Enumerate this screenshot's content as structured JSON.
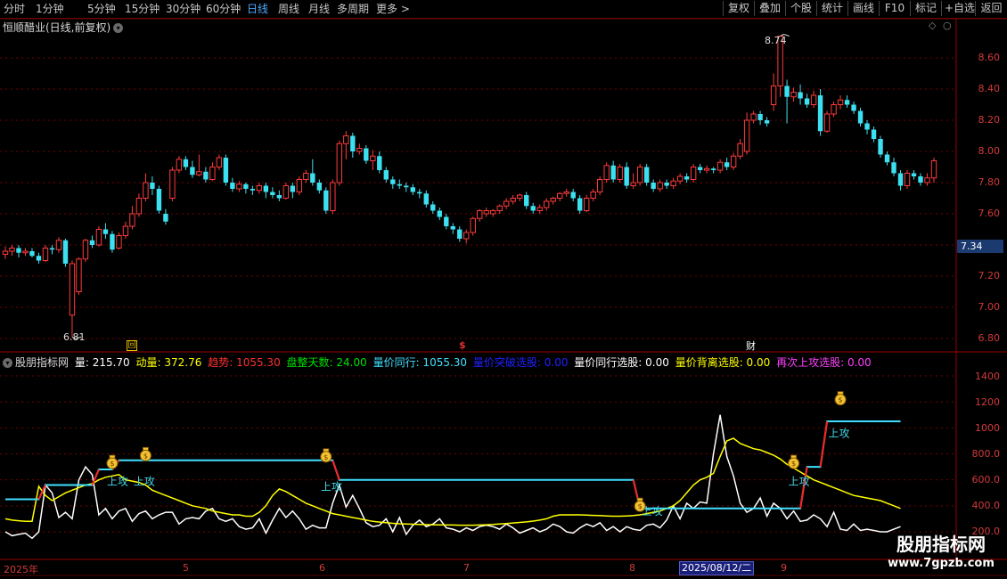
{
  "toolbar": {
    "timeframes": [
      "分时",
      "1分钟",
      "5分钟",
      "15分钟",
      "30分钟",
      "60分钟",
      "日线",
      "周线",
      "月线",
      "多周期",
      "更多 >"
    ],
    "active_timeframe": "日线",
    "buttons": [
      "复权",
      "叠加",
      "个股",
      "统计",
      "画线",
      "F10",
      "标记",
      "+自选",
      "返回"
    ]
  },
  "main_chart": {
    "title": "恒顺醋业(日线,前复权)",
    "price_axis": [
      "8.60",
      "8.40",
      "8.20",
      "8.00",
      "7.80",
      "7.60",
      "7.40",
      "7.20",
      "7.00",
      "6.80"
    ],
    "current_price": "7.34",
    "high_label": "8.74",
    "low_label": "6.81",
    "event_markers": [
      {
        "text": "回",
        "color": "#e8c000"
      },
      {
        "text": "$",
        "color": "#e03030"
      },
      {
        "text": "财",
        "color": "#ffffff"
      }
    ]
  },
  "indicator": {
    "name": "股朋指标网",
    "values": [
      {
        "text": "量: 215.70",
        "color": "#ffffff"
      },
      {
        "text": "动量: 372.76",
        "color": "#ffff00"
      },
      {
        "text": "趋势: 1055.30",
        "color": "#ff3030"
      },
      {
        "text": "盘整天数: 24.00",
        "color": "#00e000"
      },
      {
        "text": "量价同行: 1055.30",
        "color": "#40e0ff"
      },
      {
        "text": "量价突破选股: 0.00",
        "color": "#2020ff"
      },
      {
        "text": "量价同行选股: 0.00",
        "color": "#ffffff"
      },
      {
        "text": "量价背离选股: 0.00",
        "color": "#ffff00"
      },
      {
        "text": "再次上攻选股: 0.00",
        "color": "#ff40ff"
      }
    ],
    "axis": [
      "1400",
      "1200",
      "1000",
      "800.0",
      "600.0",
      "400.0",
      "200.0"
    ],
    "signal_text": "上攻"
  },
  "dates": {
    "labels": [
      "2025年",
      "5",
      "6",
      "7",
      "8",
      "9"
    ],
    "selected": "2025/08/12/二"
  },
  "watermark": {
    "line1": "股朋指标网",
    "line2": "www.7gpzb.com"
  },
  "colors": {
    "up": "#ff3b3b",
    "down": "#3ce0f0",
    "grid": "#7a0000",
    "axis_text": "#d23a3a"
  },
  "chart_data": {
    "type": "candlestick",
    "price_range": [
      6.75,
      8.78
    ],
    "candles": [
      [
        7.34,
        7.36,
        7.31,
        7.39
      ],
      [
        7.36,
        7.38,
        7.33,
        7.4
      ],
      [
        7.38,
        7.35,
        7.32,
        7.4
      ],
      [
        7.35,
        7.36,
        7.33,
        7.38
      ],
      [
        7.36,
        7.33,
        7.32,
        7.38
      ],
      [
        7.33,
        7.3,
        7.28,
        7.35
      ],
      [
        7.3,
        7.38,
        7.29,
        7.4
      ],
      [
        7.38,
        7.37,
        7.34,
        7.4
      ],
      [
        7.37,
        7.43,
        7.35,
        7.45
      ],
      [
        7.43,
        7.28,
        7.26,
        7.44
      ],
      [
        6.95,
        7.28,
        6.81,
        7.3
      ],
      [
        7.1,
        7.31,
        7.08,
        7.32
      ],
      [
        7.31,
        7.43,
        7.29,
        7.44
      ],
      [
        7.43,
        7.4,
        7.38,
        7.46
      ],
      [
        7.4,
        7.5,
        7.39,
        7.52
      ],
      [
        7.5,
        7.47,
        7.44,
        7.54
      ],
      [
        7.47,
        7.37,
        7.35,
        7.49
      ],
      [
        7.38,
        7.46,
        7.37,
        7.48
      ],
      [
        7.46,
        7.52,
        7.44,
        7.55
      ],
      [
        7.52,
        7.6,
        7.5,
        7.65
      ],
      [
        7.6,
        7.7,
        7.58,
        7.73
      ],
      [
        7.7,
        7.8,
        7.68,
        7.86
      ],
      [
        7.8,
        7.76,
        7.72,
        7.84
      ],
      [
        7.76,
        7.62,
        7.6,
        7.78
      ],
      [
        7.6,
        7.55,
        7.53,
        7.63
      ],
      [
        7.7,
        7.88,
        7.68,
        7.9
      ],
      [
        7.88,
        7.95,
        7.86,
        7.97
      ],
      [
        7.95,
        7.9,
        7.88,
        7.97
      ],
      [
        7.9,
        7.85,
        7.83,
        7.94
      ],
      [
        7.85,
        7.87,
        7.84,
        7.98
      ],
      [
        7.87,
        7.82,
        7.8,
        7.9
      ],
      [
        7.82,
        7.9,
        7.81,
        7.93
      ],
      [
        7.9,
        7.96,
        7.88,
        7.98
      ],
      [
        7.96,
        7.8,
        7.78,
        7.98
      ],
      [
        7.8,
        7.76,
        7.74,
        7.83
      ],
      [
        7.76,
        7.79,
        7.74,
        7.81
      ],
      [
        7.79,
        7.76,
        7.73,
        7.8
      ],
      [
        7.76,
        7.75,
        7.72,
        7.78
      ],
      [
        7.75,
        7.78,
        7.73,
        7.8
      ],
      [
        7.78,
        7.74,
        7.7,
        7.8
      ],
      [
        7.74,
        7.72,
        7.7,
        7.77
      ],
      [
        7.72,
        7.7,
        7.68,
        7.75
      ],
      [
        7.7,
        7.78,
        7.69,
        7.8
      ],
      [
        7.78,
        7.74,
        7.7,
        7.8
      ],
      [
        7.74,
        7.82,
        7.72,
        7.84
      ],
      [
        7.82,
        7.86,
        7.8,
        7.88
      ],
      [
        7.86,
        7.8,
        7.78,
        7.95
      ],
      [
        7.8,
        7.75,
        7.73,
        7.82
      ],
      [
        7.75,
        7.62,
        7.6,
        7.77
      ],
      [
        7.62,
        7.8,
        7.6,
        7.82
      ],
      [
        7.8,
        8.05,
        7.78,
        8.07
      ],
      [
        8.05,
        8.1,
        7.95,
        8.13
      ],
      [
        8.1,
        8.0,
        7.96,
        8.12
      ],
      [
        8.0,
        8.02,
        7.98,
        8.05
      ],
      [
        8.02,
        7.94,
        7.92,
        8.04
      ],
      [
        7.94,
        7.97,
        7.88,
        8.01
      ],
      [
        7.97,
        7.88,
        7.86,
        8.0
      ],
      [
        7.88,
        7.82,
        7.8,
        7.9
      ],
      [
        7.82,
        7.79,
        7.76,
        7.84
      ],
      [
        7.79,
        7.78,
        7.76,
        7.82
      ],
      [
        7.78,
        7.77,
        7.74,
        7.8
      ],
      [
        7.77,
        7.74,
        7.72,
        7.79
      ],
      [
        7.74,
        7.73,
        7.7,
        7.76
      ],
      [
        7.73,
        7.66,
        7.64,
        7.75
      ],
      [
        7.66,
        7.62,
        7.6,
        7.68
      ],
      [
        7.62,
        7.58,
        7.56,
        7.64
      ],
      [
        7.58,
        7.52,
        7.5,
        7.6
      ],
      [
        7.52,
        7.5,
        7.47,
        7.54
      ],
      [
        7.5,
        7.44,
        7.42,
        7.52
      ],
      [
        7.44,
        7.48,
        7.41,
        7.5
      ],
      [
        7.48,
        7.57,
        7.46,
        7.58
      ],
      [
        7.57,
        7.62,
        7.55,
        7.63
      ],
      [
        7.6,
        7.62,
        7.58,
        7.64
      ],
      [
        7.6,
        7.62,
        7.58,
        7.63
      ],
      [
        7.62,
        7.65,
        7.6,
        7.66
      ],
      [
        7.65,
        7.68,
        7.63,
        7.7
      ],
      [
        7.68,
        7.7,
        7.66,
        7.72
      ],
      [
        7.7,
        7.72,
        7.68,
        7.73
      ],
      [
        7.72,
        7.65,
        7.63,
        7.74
      ],
      [
        7.65,
        7.62,
        7.6,
        7.67
      ],
      [
        7.62,
        7.64,
        7.6,
        7.66
      ],
      [
        7.64,
        7.68,
        7.62,
        7.7
      ],
      [
        7.68,
        7.7,
        7.66,
        7.71
      ],
      [
        7.7,
        7.73,
        7.68,
        7.74
      ],
      [
        7.73,
        7.74,
        7.71,
        7.76
      ],
      [
        7.74,
        7.7,
        7.68,
        7.76
      ],
      [
        7.7,
        7.62,
        7.6,
        7.72
      ],
      [
        7.62,
        7.7,
        7.61,
        7.72
      ],
      [
        7.7,
        7.74,
        7.68,
        7.76
      ],
      [
        7.74,
        7.82,
        7.72,
        7.84
      ],
      [
        7.82,
        7.91,
        7.8,
        7.93
      ],
      [
        7.91,
        7.82,
        7.8,
        7.94
      ],
      [
        7.82,
        7.9,
        7.8,
        7.92
      ],
      [
        7.9,
        7.78,
        7.76,
        7.93
      ],
      [
        7.78,
        7.8,
        7.76,
        7.86
      ],
      [
        7.8,
        7.9,
        7.78,
        7.92
      ],
      [
        7.9,
        7.8,
        7.78,
        7.92
      ],
      [
        7.8,
        7.76,
        7.74,
        7.82
      ],
      [
        7.76,
        7.8,
        7.74,
        7.82
      ],
      [
        7.8,
        7.78,
        7.76,
        7.82
      ],
      [
        7.78,
        7.81,
        7.76,
        7.83
      ],
      [
        7.81,
        7.84,
        7.79,
        7.86
      ],
      [
        7.84,
        7.82,
        7.8,
        7.86
      ],
      [
        7.82,
        7.9,
        7.8,
        7.92
      ],
      [
        7.9,
        7.88,
        7.86,
        7.92
      ],
      [
        7.88,
        7.89,
        7.86,
        7.91
      ],
      [
        7.89,
        7.88,
        7.86,
        7.9
      ],
      [
        7.88,
        7.93,
        7.86,
        7.95
      ],
      [
        7.93,
        7.9,
        7.88,
        7.96
      ],
      [
        7.9,
        7.97,
        7.88,
        7.99
      ],
      [
        7.97,
        8.05,
        7.95,
        8.08
      ],
      [
        8.0,
        8.2,
        7.98,
        8.25
      ],
      [
        8.2,
        8.24,
        8.18,
        8.26
      ],
      [
        8.24,
        8.2,
        8.17,
        8.26
      ],
      [
        8.2,
        8.18,
        8.16,
        8.22
      ],
      [
        8.3,
        8.42,
        8.26,
        8.5
      ],
      [
        8.42,
        8.74,
        8.35,
        8.74
      ],
      [
        8.42,
        8.35,
        8.18,
        8.46
      ],
      [
        8.35,
        8.38,
        8.32,
        8.41
      ],
      [
        8.38,
        8.34,
        8.3,
        8.43
      ],
      [
        8.34,
        8.3,
        8.28,
        8.37
      ],
      [
        8.3,
        8.36,
        8.28,
        8.39
      ],
      [
        8.36,
        8.13,
        8.1,
        8.4
      ],
      [
        8.13,
        8.24,
        8.12,
        8.26
      ],
      [
        8.24,
        8.3,
        8.22,
        8.32
      ],
      [
        8.3,
        8.33,
        8.27,
        8.36
      ],
      [
        8.33,
        8.3,
        8.28,
        8.36
      ],
      [
        8.3,
        8.26,
        8.24,
        8.32
      ],
      [
        8.26,
        8.18,
        8.16,
        8.28
      ],
      [
        8.18,
        8.14,
        8.11,
        8.2
      ],
      [
        8.14,
        8.08,
        8.06,
        8.16
      ],
      [
        8.08,
        7.98,
        7.96,
        8.1
      ],
      [
        7.98,
        7.93,
        7.91,
        8.0
      ],
      [
        7.93,
        7.86,
        7.84,
        7.96
      ],
      [
        7.86,
        7.78,
        7.75,
        7.88
      ],
      [
        7.78,
        7.86,
        7.76,
        7.88
      ],
      [
        7.86,
        7.84,
        7.82,
        7.88
      ],
      [
        7.84,
        7.8,
        7.78,
        7.86
      ],
      [
        7.8,
        7.83,
        7.78,
        7.86
      ],
      [
        7.83,
        7.94,
        7.8,
        7.96
      ]
    ],
    "indicator_range": [
      190,
      1450
    ],
    "series": [
      {
        "name": "量",
        "color": "#ffffff",
        "values": [
          200,
          170,
          180,
          190,
          150,
          200,
          560,
          500,
          310,
          350,
          300,
          600,
          700,
          640,
          330,
          380,
          300,
          360,
          380,
          280,
          340,
          360,
          300,
          330,
          350,
          350,
          260,
          300,
          310,
          300,
          360,
          380,
          300,
          280,
          300,
          240,
          220,
          230,
          300,
          190,
          290,
          380,
          310,
          360,
          300,
          220,
          250,
          230,
          230,
          420,
          560,
          390,
          480,
          380,
          270,
          240,
          250,
          300,
          200,
          310,
          180,
          250,
          290,
          240,
          260,
          300,
          230,
          220,
          200,
          230,
          210,
          240,
          250,
          240,
          220,
          260,
          230,
          190,
          210,
          230,
          200,
          220,
          260,
          240,
          200,
          190,
          230,
          260,
          240,
          270,
          210,
          240,
          200,
          240,
          220,
          210,
          250,
          260,
          230,
          290,
          400,
          300,
          420,
          380,
          430,
          420,
          800,
          1100,
          780,
          630,
          420,
          350,
          380,
          460,
          320,
          420,
          380,
          300,
          360,
          280,
          290,
          330,
          300,
          240,
          350,
          220,
          210,
          260,
          210,
          220,
          210,
          200,
          200,
          220,
          240
        ]
      },
      {
        "name": "动量",
        "color": "#ffff00",
        "values": [
          300,
          290,
          285,
          280,
          280,
          550,
          480,
          440,
          470,
          500,
          520,
          540,
          560,
          570,
          600,
          620,
          630,
          640,
          600,
          590,
          580,
          560,
          520,
          500,
          480,
          460,
          440,
          420,
          400,
          390,
          380,
          360,
          350,
          340,
          330,
          330,
          320,
          320,
          350,
          400,
          480,
          530,
          510,
          480,
          450,
          420,
          400,
          380,
          360,
          340,
          330,
          320,
          310,
          300,
          290,
          280,
          275,
          270,
          265,
          262,
          260,
          258,
          256,
          255,
          254,
          253,
          252,
          252,
          251,
          251,
          251,
          252,
          254,
          256,
          260,
          264,
          268,
          272,
          276,
          282,
          290,
          300,
          320,
          330,
          330,
          330,
          330,
          328,
          326,
          325,
          322,
          320,
          320,
          322,
          325,
          330,
          340,
          350,
          360,
          380,
          400,
          440,
          500,
          560,
          600,
          620,
          650,
          780,
          900,
          920,
          880,
          860,
          840,
          830,
          810,
          790,
          760,
          720,
          690,
          660,
          630,
          600,
          580,
          560,
          540,
          520,
          500,
          480,
          470,
          460,
          450,
          440,
          420,
          400,
          380
        ]
      },
      {
        "name": "量价同行",
        "color": "#40e0ff",
        "values": [
          450,
          450,
          450,
          450,
          450,
          450,
          560,
          560,
          560,
          560,
          560,
          560,
          560,
          560,
          680,
          680,
          680,
          750,
          750,
          750,
          750,
          750,
          750,
          750,
          750,
          750,
          750,
          750,
          750,
          750,
          750,
          750,
          750,
          750,
          750,
          750,
          750,
          750,
          750,
          750,
          750,
          750,
          750,
          750,
          750,
          750,
          750,
          750,
          750,
          750,
          600,
          600,
          600,
          600,
          600,
          600,
          600,
          600,
          600,
          600,
          600,
          600,
          600,
          600,
          600,
          600,
          600,
          600,
          600,
          600,
          600,
          600,
          600,
          600,
          600,
          600,
          600,
          600,
          600,
          600,
          600,
          600,
          600,
          600,
          600,
          600,
          600,
          600,
          600,
          600,
          600,
          600,
          600,
          600,
          600,
          380,
          380,
          380,
          380,
          380,
          380,
          380,
          380,
          380,
          380,
          380,
          380,
          380,
          380,
          380,
          380,
          380,
          380,
          380,
          380,
          380,
          380,
          380,
          380,
          380,
          700,
          700,
          700,
          1050,
          1050,
          1050,
          1050,
          1050,
          1050,
          1050,
          1050,
          1050,
          1050,
          1050,
          1050
        ]
      }
    ]
  }
}
